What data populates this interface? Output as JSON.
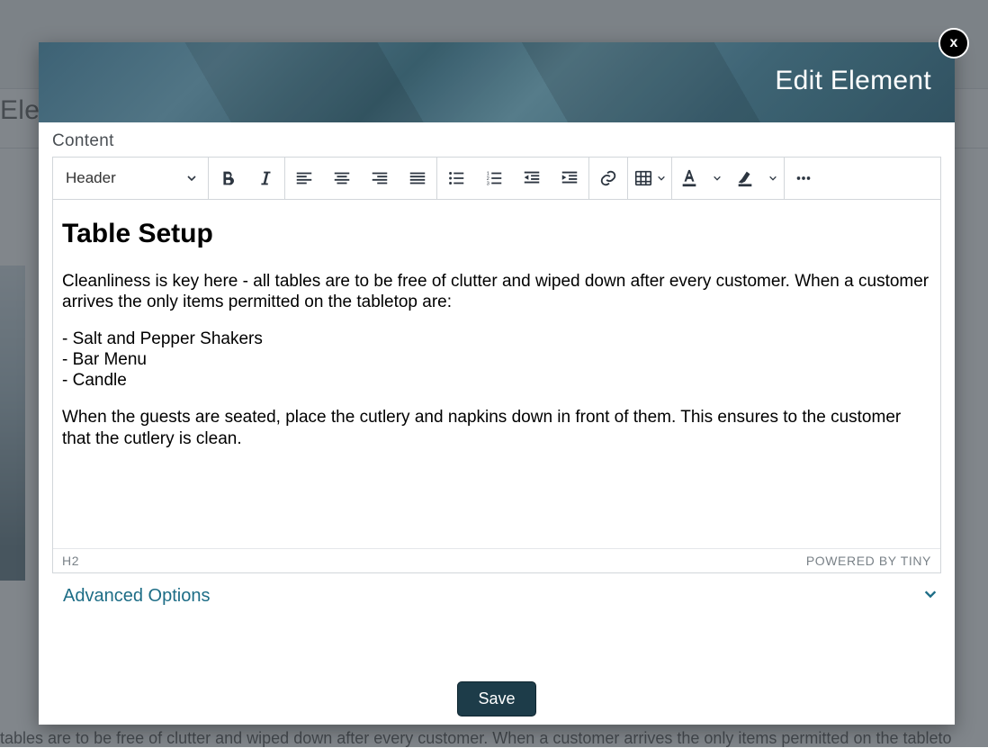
{
  "background": {
    "title_fragment": "Eleı",
    "footer_fragment": "tables are to be free of clutter and wiped down after every customer.  When a customer arrives the only items permitted on the tableto"
  },
  "modal": {
    "close_label": "x",
    "title": "Edit Element",
    "content_label": "Content",
    "advanced_options_label": "Advanced Options",
    "save_label": "Save"
  },
  "toolbar": {
    "format_label": "Header"
  },
  "editor": {
    "heading": "Table Setup",
    "para1": "Cleanliness is key here - all tables are to be free of clutter and wiped down after every customer.  When a customer arrives the only items permitted on the tabletop are:",
    "item1": "- Salt and Pepper Shakers",
    "item2": "- Bar Menu",
    "item3": "- Candle",
    "para2": "When the guests are seated, place the cutlery and napkins down in front of them.  This ensures to the customer that the cutlery is clean.",
    "status_path": "H2",
    "powered_by": "POWERED BY TINY"
  }
}
